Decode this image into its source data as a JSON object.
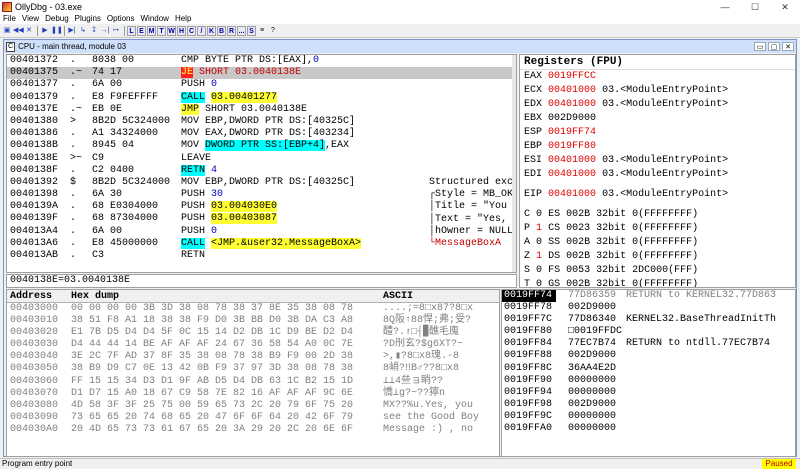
{
  "window": {
    "title": "OllyDbg - 03.exe",
    "minimize": "—",
    "maximize": "☐",
    "close": "✕"
  },
  "menu": [
    "File",
    "View",
    "Debug",
    "Plugins",
    "Options",
    "Window",
    "Help"
  ],
  "toolbar": {
    "buttons": [
      "▣",
      "◀◀",
      "✕",
      "▶",
      "❚❚",
      "▶|",
      "↳",
      "↧",
      "→|",
      "↦"
    ],
    "letters": [
      "L",
      "E",
      "M",
      "T",
      "W",
      "H",
      "C",
      "/",
      "K",
      "B",
      "R",
      "...",
      "S"
    ],
    "extra": [
      "≡",
      "?"
    ]
  },
  "cpu_window": {
    "badge": "C",
    "title": "CPU - main thread, module 03",
    "buttons": [
      "▭",
      "▢",
      "✕"
    ]
  },
  "disasm": [
    {
      "addr": "00401372",
      "mark": ".",
      "hex": "8038 00",
      "inst": [
        {
          "t": "CMP BYTE PTR DS:[EAX],"
        },
        {
          "t": "0",
          "c": "iarg"
        }
      ]
    },
    {
      "addr": "00401375",
      "mark": ".~",
      "hex": "74 17",
      "inst": [
        {
          "t": "JE",
          "c": "hl-red"
        },
        {
          "t": " SHORT 03.0040138E",
          "c": "aarg-red"
        }
      ],
      "sel": true
    },
    {
      "addr": "00401377",
      "mark": ".",
      "hex": "6A 00",
      "inst": [
        {
          "t": "PUSH "
        },
        {
          "t": "0",
          "c": "iarg"
        }
      ]
    },
    {
      "addr": "00401379",
      "mark": ".",
      "hex": "E8 F9FEFFFF",
      "inst": [
        {
          "t": "CALL",
          "c": "hl-cyan"
        },
        {
          "t": " "
        },
        {
          "t": "03.00401277",
          "c": "hl-yellow"
        }
      ]
    },
    {
      "addr": "0040137E",
      "mark": ".~",
      "hex": "EB 0E",
      "inst": [
        {
          "t": "JMP",
          "c": "hl-yellow"
        },
        {
          "t": " SHORT 03.0040138E"
        }
      ]
    },
    {
      "addr": "00401380",
      "mark": ">",
      "hex": "8B2D 5C324000",
      "inst": [
        {
          "t": "MOV EBP,DWORD PTR DS:[40325C]"
        }
      ]
    },
    {
      "addr": "00401386",
      "mark": ".",
      "hex": "A1 34324000",
      "inst": [
        {
          "t": "MOV EAX,DWORD PTR DS:[403234]"
        }
      ]
    },
    {
      "addr": "0040138B",
      "mark": ".",
      "hex": "8945 04",
      "inst": [
        {
          "t": "MOV "
        },
        {
          "t": "DWORD PTR SS:[EBP+4]",
          "c": "hl-blue"
        },
        {
          "t": ",EAX"
        }
      ]
    },
    {
      "addr": "0040138E",
      "mark": ">~",
      "hex": "C9",
      "inst": [
        {
          "t": "LEAVE"
        }
      ]
    },
    {
      "addr": "0040138F",
      "mark": ".",
      "hex": "C2 0400",
      "inst": [
        {
          "t": "RETN",
          "c": "hl-cyan"
        },
        {
          "t": " "
        },
        {
          "t": "4",
          "c": "iarg"
        }
      ]
    },
    {
      "addr": "00401392",
      "mark": "$",
      "hex": "8B2D 5C324000",
      "inst": [
        {
          "t": "MOV EBP,DWORD PTR DS:[40325C]"
        }
      ]
    },
    {
      "addr": "00401398",
      "mark": ".",
      "hex": "6A 30",
      "inst": [
        {
          "t": "PUSH "
        },
        {
          "t": "30",
          "c": "iarg"
        }
      ]
    },
    {
      "addr": "0040139A",
      "mark": ".",
      "hex": "68 E0304000",
      "inst": [
        {
          "t": "PUSH "
        },
        {
          "t": "03.004030E0",
          "c": "hl-yellow"
        }
      ]
    },
    {
      "addr": "0040139F",
      "mark": ".",
      "hex": "68 87304000",
      "inst": [
        {
          "t": "PUSH "
        },
        {
          "t": "03.00403087",
          "c": "hl-yellow"
        }
      ]
    },
    {
      "addr": "004013A4",
      "mark": ".",
      "hex": "6A 00",
      "inst": [
        {
          "t": "PUSH "
        },
        {
          "t": "0",
          "c": "iarg"
        }
      ]
    },
    {
      "addr": "004013A6",
      "mark": ".",
      "hex": "E8 45000000",
      "inst": [
        {
          "t": "CALL",
          "c": "hl-cyan"
        },
        {
          "t": " "
        },
        {
          "t": "<JMP.&user32.MessageBoxA>",
          "c": "hl-yellow"
        }
      ]
    },
    {
      "addr": "004013AB",
      "mark": ".",
      "hex": "C3",
      "inst": [
        {
          "t": "RETN"
        }
      ]
    }
  ],
  "comments": [
    {
      "row": 10,
      "text": "Structured except"
    },
    {
      "row": 11,
      "text": "┌Style = MB_OK|MB_"
    },
    {
      "row": 12,
      "text": "│Title = \"You succ"
    },
    {
      "row": 13,
      "text": "│Text = \"Yes, you s"
    },
    {
      "row": 14,
      "text": "│hOwner = NULL"
    },
    {
      "row": 15,
      "text": "└MessageBoxA",
      "red": true
    }
  ],
  "infoline": "0040138E=03.0040138E",
  "registers": {
    "title": "Registers (FPU)",
    "rows": [
      {
        "name": "EAX",
        "value": "0019FFCC",
        "red": true,
        "extra": ""
      },
      {
        "name": "ECX",
        "value": "00401000",
        "red": true,
        "extra": "03.<ModuleEntryPoint>"
      },
      {
        "name": "EDX",
        "value": "00401000",
        "red": true,
        "extra": "03.<ModuleEntryPoint>"
      },
      {
        "name": "EBX",
        "value": "002D9000",
        "red": false,
        "extra": ""
      },
      {
        "name": "ESP",
        "value": "0019FF74",
        "red": true,
        "extra": ""
      },
      {
        "name": "EBP",
        "value": "0019FF80",
        "red": true,
        "extra": ""
      },
      {
        "name": "ESI",
        "value": "00401000",
        "red": true,
        "extra": "03.<ModuleEntryPoint>"
      },
      {
        "name": "EDI",
        "value": "00401000",
        "red": true,
        "extra": "03.<ModuleEntryPoint>"
      }
    ],
    "eip": {
      "name": "EIP",
      "value": "00401000",
      "extra": "03.<ModuleEntryPoint>"
    },
    "flags": [
      {
        "f": "C",
        "v": "0",
        "seg": "ES 002B 32bit 0(FFFFFFFF)",
        "red": false
      },
      {
        "f": "P",
        "v": "1",
        "seg": "CS 0023 32bit 0(FFFFFFFF)",
        "red": true
      },
      {
        "f": "A",
        "v": "0",
        "seg": "SS 002B 32bit 0(FFFFFFFF)",
        "red": false
      },
      {
        "f": "Z",
        "v": "1",
        "seg": "DS 002B 32bit 0(FFFFFFFF)",
        "red": true
      },
      {
        "f": "S",
        "v": "0",
        "seg": "FS 0053 32bit 2DC000(FFF)",
        "red": false
      },
      {
        "f": "T",
        "v": "0",
        "seg": "GS 002B 32bit 0(FFFFFFFF)",
        "red": false
      }
    ]
  },
  "dump": {
    "headers": {
      "address": "Address",
      "hex": "Hex dump",
      "ascii": "ASCII"
    },
    "rows": [
      {
        "addr": "00403000",
        "hex": "00 00 00 00 3B 3D 38 08 78 38 37 8E 35 38 08 78",
        "ascii": "....;=8□x87?8□x"
      },
      {
        "addr": "00403010",
        "hex": "38 51 F8 A1 18 38 38 F9 D0 3B BB D0 3B DA C3 A8",
        "ascii": "8Q阪↑88悍;弗;受?"
      },
      {
        "addr": "00403020",
        "hex": "E1 7B D5 D4 D4 5F 0C 15 14 D2 DB 1C D9 BE D2 D4",
        "ascii": "醴?.↾□┤▉醮毛廆"
      },
      {
        "addr": "00403030",
        "hex": "D4 44 44 14 BE AF AF AF 24 67 36 58 54 A0 0C 7E",
        "ascii": "?D刐⽞?$g6XT?~"
      },
      {
        "addr": "00403040",
        "hex": "3E 2C 7F AD 37 8F 35 38 08 78 38 B9 F9 00 2D 38",
        "ascii": ">,▮?8□x8瑰.-8"
      },
      {
        "addr": "00403050",
        "hex": "38 B9 D9 C7 0E 13 42 0B F9 37 97 3D 38 08 78 38",
        "ascii": "8峭?‼B♂??8□x8"
      },
      {
        "addr": "00403060",
        "hex": "FF 15 15 34 D3 D1 9F AB D5 D4 DB 63 1C B2 15 1D",
        "ascii": " ⊥⊥4亝ョ睄??"
      },
      {
        "addr": "00403070",
        "hex": "D1 D7 15 A0 18 67 C9 58 7E 82 16 AF AF AF 9C 6E",
        "ascii": "憍⊥g?~??獰n"
      },
      {
        "addr": "00403080",
        "hex": "4D 58 3F 3F 25 75 00 59 65 73 2C 20 79 6F 75 20",
        "ascii": "MX??%u.Yes, you"
      },
      {
        "addr": "00403090",
        "hex": "73 65 65 20 74 68 65 20 47 6F 6F 64 20 42 6F 79",
        "ascii": "see the Good Boy"
      },
      {
        "addr": "004030A0",
        "hex": "20 4D 65 73 73 61 67 65 20 3A 29 20 2C 20 6E 6F",
        "ascii": " Message :) , no"
      }
    ]
  },
  "stack": [
    {
      "addr": "0019FF74",
      "val": "77D86359",
      "com": "RETURN to KERNEL32.77D863",
      "sel": true
    },
    {
      "addr": "0019FF78",
      "val": "002D9000",
      "com": ""
    },
    {
      "addr": "0019FF7C",
      "val": "77D86340",
      "com": "KERNEL32.BaseThreadInitTh"
    },
    {
      "addr": "0019FF80",
      "val": "□0019FFDC",
      "com": ""
    },
    {
      "addr": "0019FF84",
      "val": "77EC7B74",
      "com": "RETURN to ntdll.77EC7B74"
    },
    {
      "addr": "0019FF88",
      "val": "002D9000",
      "com": ""
    },
    {
      "addr": "0019FF8C",
      "val": "36AA4E2D",
      "com": ""
    },
    {
      "addr": "0019FF90",
      "val": "00000000",
      "com": ""
    },
    {
      "addr": "0019FF94",
      "val": "00000000",
      "com": ""
    },
    {
      "addr": "0019FF98",
      "val": "002D9000",
      "com": ""
    },
    {
      "addr": "0019FF9C",
      "val": "00000000",
      "com": ""
    },
    {
      "addr": "0019FFA0",
      "val": "00000000",
      "com": ""
    }
  ],
  "status": {
    "text": "Program entry point",
    "state": "Paused"
  }
}
